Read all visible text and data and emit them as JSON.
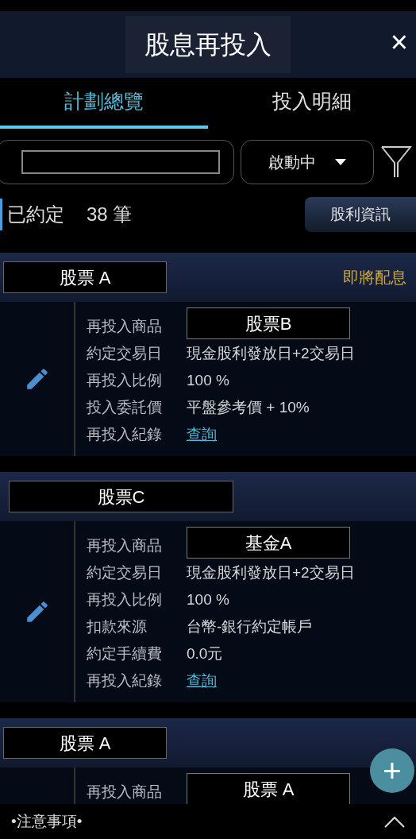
{
  "header": {
    "title": "股息再投入",
    "close": "×"
  },
  "tabs": [
    {
      "label": "計劃總覽",
      "selected": true
    },
    {
      "label": "投入明細",
      "selected": false
    }
  ],
  "filter": {
    "status": "啟動中"
  },
  "summary": {
    "label": "已約定",
    "count": "38 筆",
    "button": "股利資訊"
  },
  "plans": [
    {
      "name": "股票 A",
      "badge": "即將配息",
      "rows": [
        {
          "kind": "product",
          "label": "再投入商品",
          "value": "股票B"
        },
        {
          "kind": "text",
          "label": "約定交易日",
          "value": "現金股利發放日+2交易日"
        },
        {
          "kind": "text",
          "label": "再投入比例",
          "value": "100 %"
        },
        {
          "kind": "text",
          "label": "投入委託價",
          "value": "平盤參考價 + 10%"
        },
        {
          "kind": "link",
          "label": "再投入紀錄",
          "value": "查詢"
        }
      ]
    },
    {
      "name": "股票C",
      "rows": [
        {
          "kind": "product",
          "label": "再投入商品",
          "value": "基金A"
        },
        {
          "kind": "text",
          "label": "約定交易日",
          "value": "現金股利發放日+2交易日"
        },
        {
          "kind": "text",
          "label": "再投入比例",
          "value": "100 %"
        },
        {
          "kind": "text",
          "label": "扣款來源",
          "value": "台幣-銀行約定帳戶"
        },
        {
          "kind": "text",
          "label": "約定手續費",
          "value": "0.0元"
        },
        {
          "kind": "link",
          "label": "再投入紀錄",
          "value": "查詢"
        }
      ]
    },
    {
      "name": "股票 A",
      "rows": [
        {
          "kind": "product",
          "label": "再投入商品",
          "value": "股票 A"
        }
      ]
    }
  ],
  "add_button": "+",
  "footer": {
    "notice": "•注意事項•"
  }
}
